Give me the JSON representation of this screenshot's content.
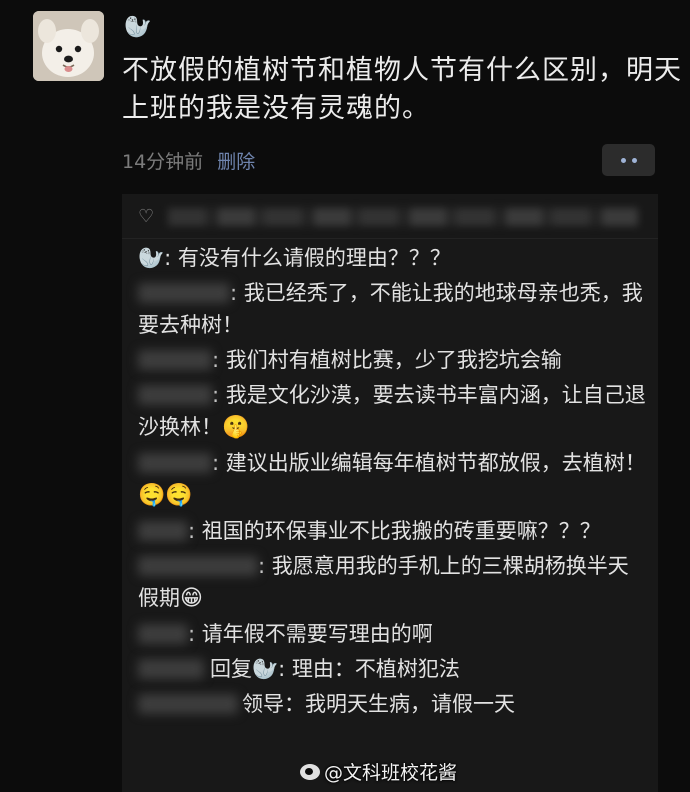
{
  "post": {
    "author_emoji": "🦭",
    "text": "不放假的植树节和植物人节有什么区别，明天上班的我是没有灵魂的。",
    "time": "14分钟前",
    "delete_label": "删除"
  },
  "comments": [
    {
      "emoji": "🦭",
      "text": ": 有没有什么请假的理由？？？"
    },
    {
      "text": ": 我已经秃了，不能让我的地球母亲也秃，我要去种树！"
    },
    {
      "text": ": 我们村有植树比赛，少了我挖坑会输"
    },
    {
      "text": ": 我是文化沙漠，要去读书丰富内涵，让自己退沙换林！",
      "trail_emoji": "🤫"
    },
    {
      "text": ": 建议出版业编辑每年植树节都放假，去植树！",
      "trail_emoji": "🤤🤤"
    },
    {
      "text": ": 祖国的环保事业不比我搬的砖重要嘛？？？"
    },
    {
      "text": ": 我愿意用我的手机上的三棵胡杨换半天假期",
      "trail_emoji": "😁"
    },
    {
      "text": ": 请年假不需要写理由的啊"
    },
    {
      "reply_word": "回复",
      "reply_emoji": "🦭",
      "text": ": 理由：不植树犯法"
    },
    {
      "text": "领导：我明天生病，请假一天"
    }
  ],
  "watermark": "@文科班校花酱"
}
